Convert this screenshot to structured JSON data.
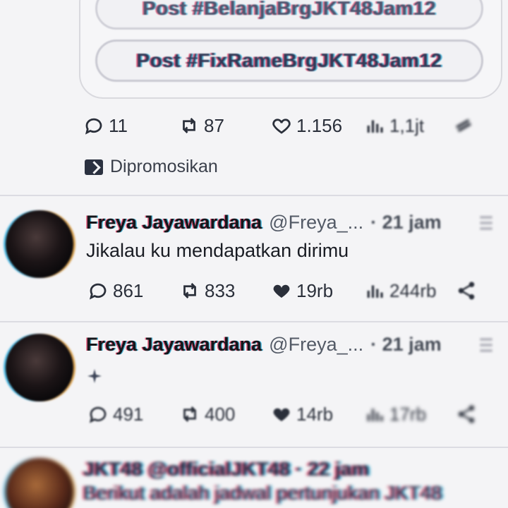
{
  "promoted_tweet": {
    "pill_1": "Post #BelanjaBrgJKT48Jam12",
    "pill_2": "Post #FixRameBrgJKT48Jam12",
    "replies": "11",
    "reposts": "87",
    "likes": "1.156",
    "views": "1,1jt",
    "promoted_label": "Dipromosikan"
  },
  "tweets": [
    {
      "name": "Freya Jayawardana",
      "handle": "@Freya_...",
      "time": "· 21 jam",
      "text": "Jikalau ku mendapatkan dirimu",
      "replies": "861",
      "reposts": "833",
      "likes": "19rb",
      "views": "244rb"
    },
    {
      "name": "Freya Jayawardana",
      "handle": "@Freya_...",
      "time": "· 21 jam",
      "text": "",
      "replies": "491",
      "reposts": "400",
      "likes": "14rb",
      "views": "17rb"
    }
  ],
  "partial_tweet": {
    "header": "JKT48 @officialJKT48 · 22 jam",
    "text": "Berikut adalah jadwal pertunjukan JKT48"
  },
  "colors": {
    "background": "#f4f4f6",
    "text": "#16181c",
    "muted": "#535a66",
    "divider": "#dcdce2"
  }
}
